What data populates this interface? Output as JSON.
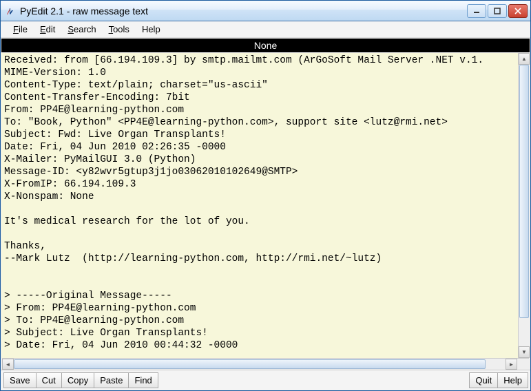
{
  "window": {
    "title": "PyEdit 2.1 - raw message text"
  },
  "menubar": {
    "file": "File",
    "edit": "Edit",
    "search": "Search",
    "tools": "Tools",
    "help": "Help"
  },
  "header": "None",
  "editor_text": "Received: from [66.194.109.3] by smtp.mailmt.com (ArGoSoft Mail Server .NET v.1.\nMIME-Version: 1.0\nContent-Type: text/plain; charset=\"us-ascii\"\nContent-Transfer-Encoding: 7bit\nFrom: PP4E@learning-python.com\nTo: \"Book, Python\" <PP4E@learning-python.com>, support site <lutz@rmi.net>\nSubject: Fwd: Live Organ Transplants!\nDate: Fri, 04 Jun 2010 02:26:35 -0000\nX-Mailer: PyMailGUI 3.0 (Python)\nMessage-ID: <y82wvr5gtup3j1jo03062010102649@SMTP>\nX-FromIP: 66.194.109.3\nX-Nonspam: None\n\nIt's medical research for the lot of you.\n\nThanks,\n--Mark Lutz  (http://learning-python.com, http://rmi.net/~lutz)\n\n\n> -----Original Message-----\n> From: PP4E@learning-python.com\n> To: PP4E@learning-python.com\n> Subject: Live Organ Transplants!\n> Date: Fri, 04 Jun 2010 00:44:32 -0000",
  "toolbar": {
    "save": "Save",
    "cut": "Cut",
    "copy": "Copy",
    "paste": "Paste",
    "find": "Find",
    "quit": "Quit",
    "help": "Help"
  }
}
